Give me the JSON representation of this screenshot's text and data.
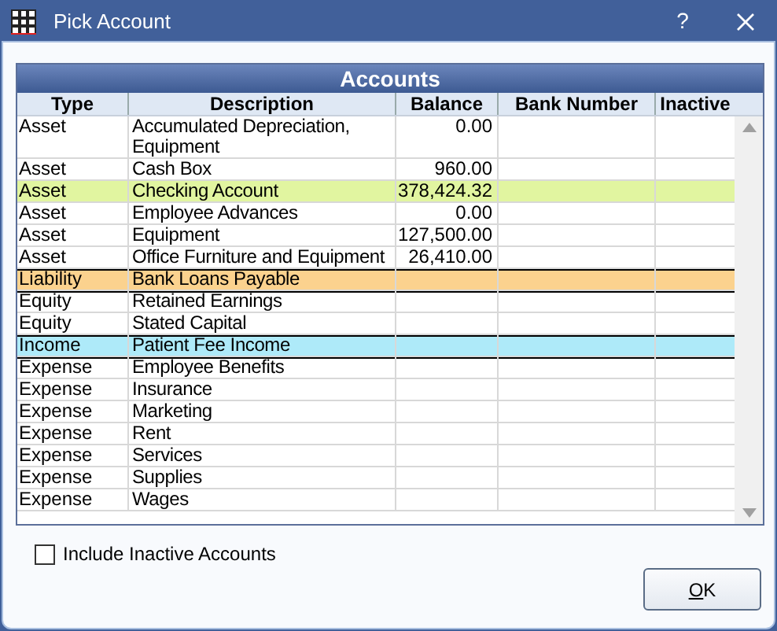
{
  "window": {
    "title": "Pick Account",
    "help": "?"
  },
  "grid": {
    "title": "Accounts",
    "columns": [
      "Type",
      "Description",
      "Balance",
      "Bank Number",
      "Inactive"
    ],
    "rows": [
      {
        "type": "Asset",
        "description": "Accumulated Depreciation, Equipment",
        "balance": "0.00",
        "color": "#ffffff",
        "separator_above": false
      },
      {
        "type": "Asset",
        "description": "Cash Box",
        "balance": "960.00",
        "color": "#ffffff",
        "separator_above": false
      },
      {
        "type": "Asset",
        "description": "Checking Account",
        "balance": "378,424.32",
        "color": "#e1f5a0",
        "separator_above": false
      },
      {
        "type": "Asset",
        "description": "Employee Advances",
        "balance": "0.00",
        "color": "#ffffff",
        "separator_above": false
      },
      {
        "type": "Asset",
        "description": "Equipment",
        "balance": "127,500.00",
        "color": "#ffffff",
        "separator_above": false
      },
      {
        "type": "Asset",
        "description": "Office Furniture and Equipment",
        "balance": "26,410.00",
        "color": "#ffffff",
        "separator_above": false
      },
      {
        "type": "Liability",
        "description": "Bank Loans Payable",
        "color": "#fbd28e",
        "separator_above": true
      },
      {
        "type": "Equity",
        "description": "Retained Earnings",
        "color": "#ffffff",
        "separator_above": true
      },
      {
        "type": "Equity",
        "description": "Stated Capital",
        "color": "#ffffff",
        "separator_above": false
      },
      {
        "type": "Income",
        "description": "Patient Fee Income",
        "color": "#aeeaf9",
        "separator_above": true
      },
      {
        "type": "Expense",
        "description": "Employee Benefits",
        "color": "#ffffff",
        "separator_above": true
      },
      {
        "type": "Expense",
        "description": "Insurance",
        "color": "#ffffff",
        "separator_above": false
      },
      {
        "type": "Expense",
        "description": "Marketing",
        "color": "#ffffff",
        "separator_above": false
      },
      {
        "type": "Expense",
        "description": "Rent",
        "color": "#ffffff",
        "separator_above": false
      },
      {
        "type": "Expense",
        "description": "Services",
        "color": "#ffffff",
        "separator_above": false
      },
      {
        "type": "Expense",
        "description": "Supplies",
        "color": "#ffffff",
        "separator_above": false
      },
      {
        "type": "Expense",
        "description": "Wages",
        "color": "#ffffff",
        "separator_above": false
      }
    ]
  },
  "include_inactive": {
    "label": "Include Inactive Accounts",
    "checked": false
  },
  "ok_button": {
    "label": "OK"
  }
}
